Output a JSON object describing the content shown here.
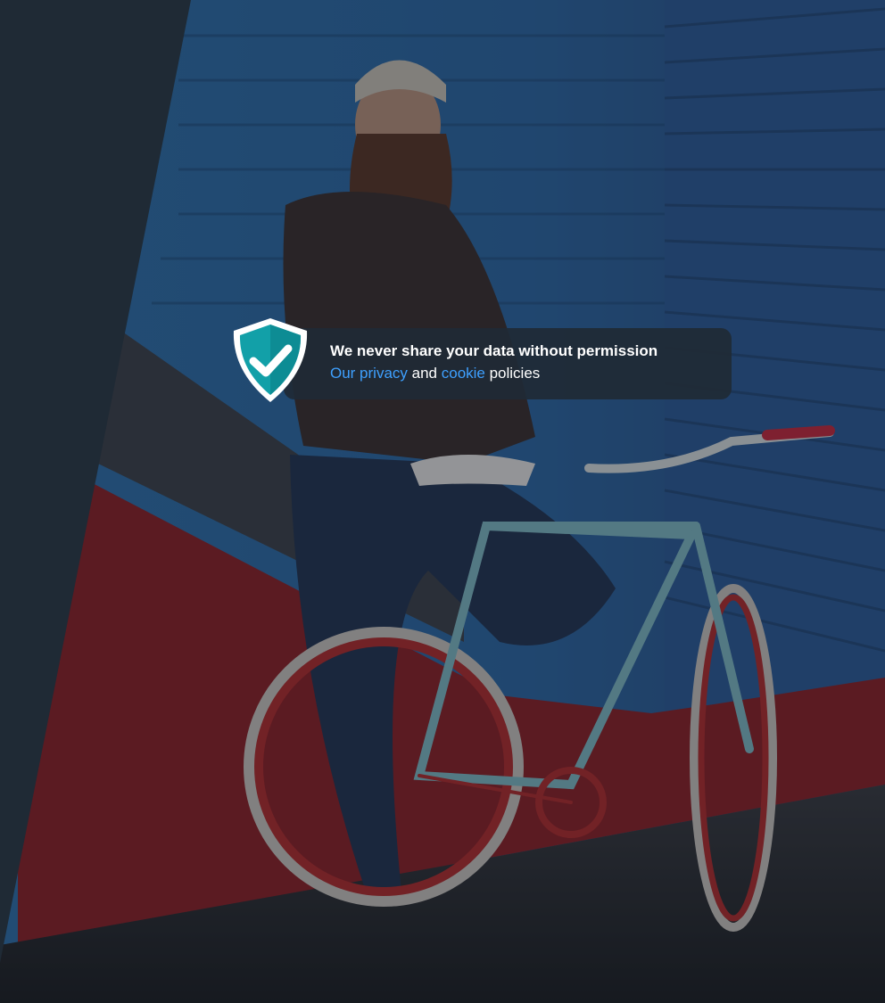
{
  "consent": {
    "headline": "We never share your data without permission",
    "link_privacy": "Our privacy",
    "and_text": " and ",
    "link_cookie": "cookie",
    "policies_text": " policies"
  },
  "colors": {
    "panel": "#1f2a35",
    "link": "#3ea0ff",
    "shield": "#12a0a8"
  },
  "icons": {
    "shield": "shield-check-icon"
  }
}
